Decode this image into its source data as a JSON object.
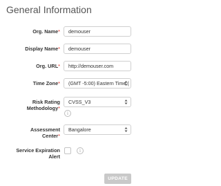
{
  "page": {
    "title": "General Information"
  },
  "form": {
    "required_marker": "*",
    "org_name": {
      "label": "Org. Name",
      "value": "demouser"
    },
    "display_name": {
      "label": "Display Name",
      "value": "demouser"
    },
    "org_url": {
      "label": "Org. URL",
      "value": "http://demouser.com"
    },
    "time_zone": {
      "label": "Time Zone",
      "value": "(GMT -5:00) Eastern Time ("
    },
    "risk_rating": {
      "label_line1": "Risk Rating",
      "label_line2": "Methodology",
      "value": "CVSS_V3"
    },
    "assessment_center": {
      "label_line1": "Assessment",
      "label_line2": "Center",
      "value": "Bangalore"
    },
    "service_expiration": {
      "label_line1": "Service Expiration",
      "label_line2": "Alert",
      "checked": false
    },
    "info_glyph": "i"
  },
  "actions": {
    "update_label": "UPDATE"
  }
}
